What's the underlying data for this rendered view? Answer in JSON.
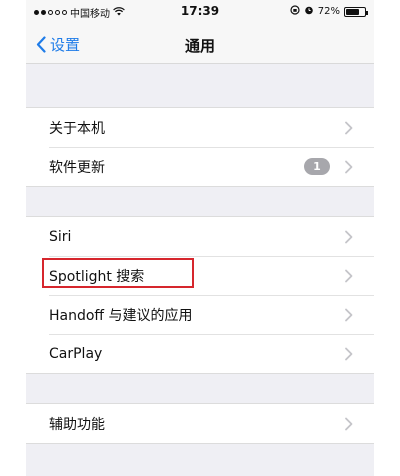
{
  "status_bar": {
    "carrier": "中国移动",
    "time": "17:39",
    "battery": "72%",
    "battery_level": 0.72
  },
  "nav": {
    "back_label": "设置",
    "title": "通用"
  },
  "groups": [
    [
      {
        "label": "关于本机"
      },
      {
        "label": "软件更新",
        "badge": "1"
      }
    ],
    [
      {
        "label": "Siri"
      },
      {
        "label": "Spotlight 搜索",
        "highlighted": true
      },
      {
        "label": "Handoff 与建议的应用"
      },
      {
        "label": "CarPlay"
      }
    ],
    [
      {
        "label": "辅助功能"
      }
    ]
  ],
  "colors": {
    "accent": "#1f7ce8",
    "highlight": "#d6262d",
    "background": "#efeff4"
  }
}
